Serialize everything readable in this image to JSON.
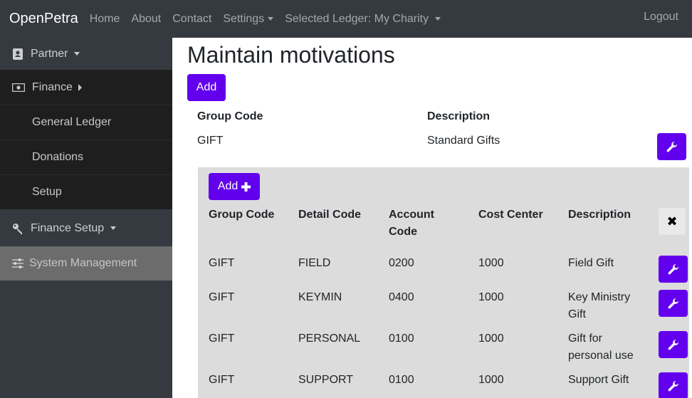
{
  "navbar": {
    "brand": "OpenPetra",
    "items": [
      {
        "label": "Home"
      },
      {
        "label": "About"
      },
      {
        "label": "Contact"
      },
      {
        "label": "Settings"
      },
      {
        "label": "Selected Ledger: My Charity"
      }
    ],
    "logout": "Logout"
  },
  "sidebar": {
    "partner": "Partner",
    "finance": "Finance",
    "sub_items": [
      "General Ledger",
      "Donations",
      "Setup"
    ],
    "finance_setup": "Finance Setup",
    "system_management": "System Management"
  },
  "main": {
    "title": "Maintain motivations",
    "add_label": "Add",
    "headers": {
      "group_code": "Group Code",
      "description": "Description"
    },
    "group_row": {
      "group_code": "GIFT",
      "description": "Standard Gifts"
    },
    "detail": {
      "add_label": "Add",
      "headers": {
        "group_code": "Group Code",
        "detail_code": "Detail Code",
        "account_code_1": "Account",
        "account_code_2": "Code",
        "cost_center": "Cost Center",
        "description": "Description"
      },
      "close_symbol": "✖",
      "rows": [
        {
          "group": "GIFT",
          "detail": "FIELD",
          "account": "0200",
          "cost": "1000",
          "desc1": "Field Gift",
          "desc2": ""
        },
        {
          "group": "GIFT",
          "detail": "KEYMIN",
          "account": "0400",
          "cost": "1000",
          "desc1": "Key Ministry",
          "desc2": "Gift"
        },
        {
          "group": "GIFT",
          "detail": "PERSONAL",
          "account": "0100",
          "cost": "1000",
          "desc1": "Gift for",
          "desc2": "personal use"
        },
        {
          "group": "GIFT",
          "detail": "SUPPORT",
          "account": "0100",
          "cost": "1000",
          "desc1": "Support Gift",
          "desc2": ""
        }
      ]
    }
  },
  "colors": {
    "navbar_bg": "#343a40",
    "primary": "#6200ee",
    "panel_bg": "#dcdcdc"
  },
  "icons": [
    "address-book-icon",
    "money-bill-icon",
    "key-icon",
    "sliders-icon",
    "wrench-icon",
    "plus-icon",
    "close-icon"
  ]
}
